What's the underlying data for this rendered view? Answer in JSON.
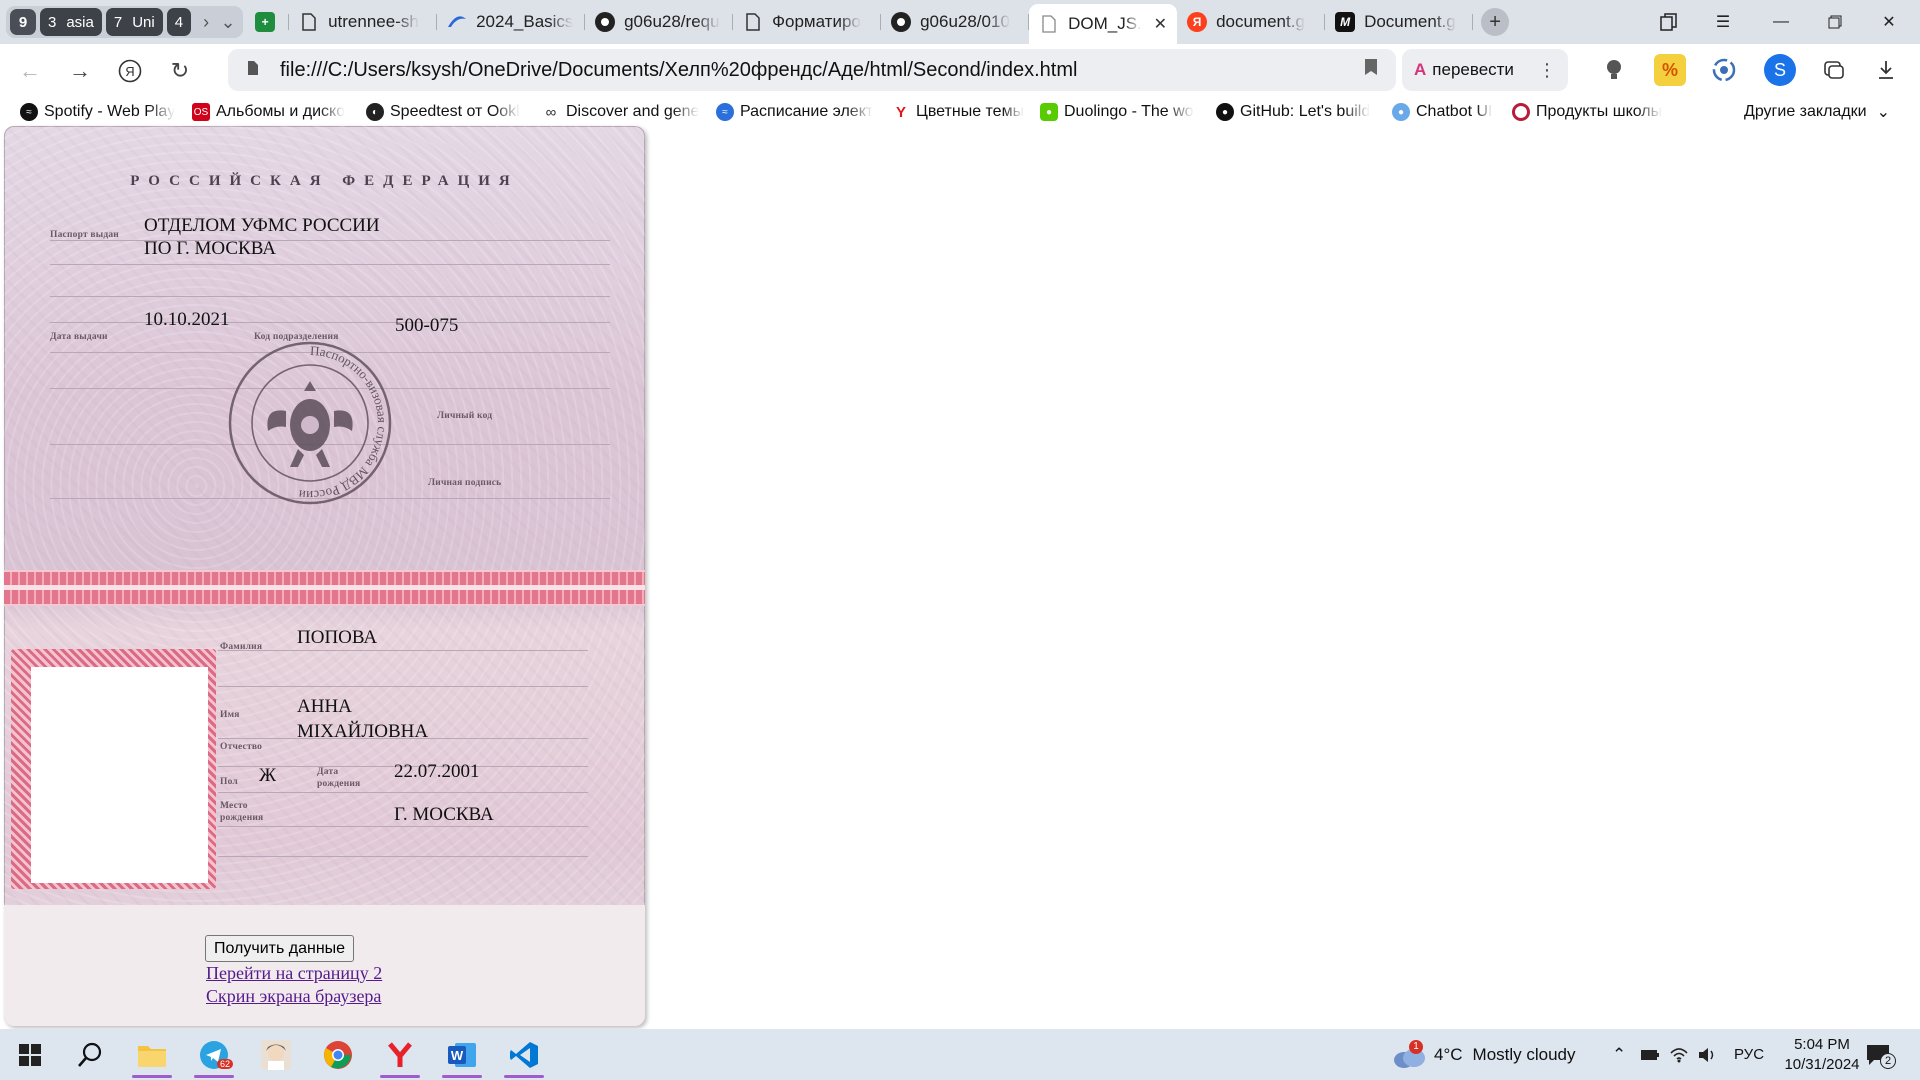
{
  "tabs": {
    "group_count": "9",
    "groups": [
      {
        "num": "3",
        "label": "asia"
      },
      {
        "num": "7",
        "label": "Uni"
      },
      {
        "num": "4",
        "label": ""
      }
    ],
    "items": [
      {
        "title": "",
        "icon": "sheets-icon",
        "color": "#1e8e3e"
      },
      {
        "title": "utrennee-sh",
        "icon": "page-icon"
      },
      {
        "title": "2024_Basics",
        "icon": "swirl-icon"
      },
      {
        "title": "g06u28/requ",
        "icon": "github-icon"
      },
      {
        "title": "Форматиро",
        "icon": "page-icon"
      },
      {
        "title": "g06u28/010",
        "icon": "github-icon"
      },
      {
        "title": "DOM_JS.",
        "icon": "file-icon",
        "active": true
      },
      {
        "title": "document.g",
        "icon": "yandex-icon"
      },
      {
        "title": "Document.g",
        "icon": "medium-icon"
      }
    ]
  },
  "address": {
    "url": "file:///C:/Users/ksysh/OneDrive/Documents/Хелп%20френдс/Аде/html/Second/index.html",
    "translate_label": "перевести"
  },
  "bookmarks": {
    "items": [
      {
        "label": "Spotify - Web Play",
        "color": "#111"
      },
      {
        "label": "Альбомы и диско",
        "color": "#d0021b",
        "badge": "OS"
      },
      {
        "label": "Speedtest от Ookl",
        "color": "#222"
      },
      {
        "label": "Discover and gene",
        "color": "#444",
        "badge": "∞"
      },
      {
        "label": "Расписание элект",
        "color": "#2a6fdb"
      },
      {
        "label": "Цветные темы",
        "color": "#e0161b",
        "badge": "Y"
      },
      {
        "label": "Duolingo - The wo",
        "color": "#58cc02"
      },
      {
        "label": "GitHub: Let's build",
        "color": "#111"
      },
      {
        "label": "Chatbot UI",
        "color": "#6aa9e9"
      },
      {
        "label": "Продукты школы",
        "color": "#b71c3b"
      }
    ],
    "other_label": "Другие закладки"
  },
  "passport": {
    "country": "РОССИЙСКАЯ ФЕДЕРАЦИЯ",
    "micro": {
      "issued_by": "Паспорт выдан",
      "issue_date": "Дата выдачи",
      "division_code": "Код подразделения",
      "personal_code": "Личный код",
      "signature": "Личная подпись",
      "surname": "Фамилия",
      "name": "Имя",
      "patronymic": "Отчество",
      "sex": "Пол",
      "birth_date_1": "Дата",
      "birth_date_2": "рождения",
      "birth_place_1": "Место",
      "birth_place_2": "рождения",
      "stamp_text": "Паспортно-визовая служба МВД России"
    },
    "issued_by_line1": "ОТДЕЛОМ УФМС РОССИИ",
    "issued_by_line2": "ПО Г. МОСКВА",
    "issue_date": "10.10.2021",
    "division_code": "500-075",
    "surname": "ПОПОВА",
    "name": "АННА",
    "patronymic": "МІХАЙЛОВНА",
    "sex": "Ж",
    "birth_date": "22.07.2001",
    "birth_place": "Г. МОСКВА"
  },
  "page_controls": {
    "get_data_button": "Получить данные",
    "link_page2": "Перейти на страницу 2",
    "link_screenshot": "Скрин экрана браузера"
  },
  "taskbar": {
    "weather_badge": "1",
    "weather": "4°C",
    "weather_text": "Mostly cloudy",
    "language": "РУС",
    "time": "5:04 PM",
    "date": "10/31/2024",
    "notifications": "2",
    "telegram_badge": "62"
  }
}
